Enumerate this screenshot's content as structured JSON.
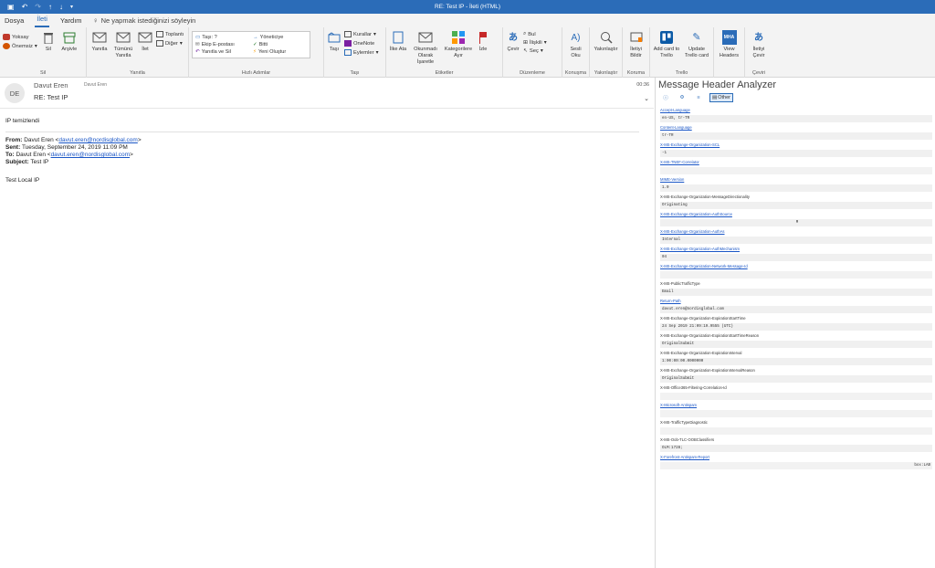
{
  "titlebar": {
    "title": "RE: Test IP  -  İleti (HTML)",
    "save_icon": "save-icon",
    "undo_icon": "undo-icon"
  },
  "tabs": [
    "Dosya",
    "İleti",
    "Yardım"
  ],
  "active_tab": "İleti",
  "tellme": "Ne yapmak istediğinizi söyleyin",
  "ribbon": {
    "sil": {
      "label": "Sil",
      "yoksay": "Yoksay",
      "onemsiz": "Önemsiz",
      "sil_btn": "Sil",
      "arsivle": "Arşivle"
    },
    "yanitla": {
      "label": "Yanıtla",
      "yanitla_btn": "Yanıtla",
      "tumunu": "Tümünü Yanıtla",
      "ilet": "İlet",
      "toplanti": "Toplantı",
      "diger": "Diğer"
    },
    "hizli": {
      "label": "Hızlı Adımlar",
      "items": [
        "Taşı: ?",
        "Yöneticiye",
        "Ekip E-postası",
        "Bitti",
        "Yanıtla ve Sil",
        "Yeni Oluştur"
      ]
    },
    "tasi": {
      "label": "Taşı",
      "tasi_btn": "Taşı",
      "kurallar": "Kurallar",
      "onenote": "OneNote",
      "eylemler": "Eylemler"
    },
    "etiketler": {
      "label": "Etiketler",
      "ilke": "İlke Ata",
      "okunmadi": "Okunmadı Olarak İşaretle",
      "kategoriler": "Kategorilere Ayır",
      "izle": "İzle"
    },
    "duzenleme": {
      "label": "Düzenleme",
      "cevir": "Çevir",
      "bul": "Bul",
      "ilgili": "İlişkili",
      "sec": "Seç"
    },
    "konusma": {
      "label": "Konuşma",
      "sesli": "Sesli Oku"
    },
    "yakinlastir": {
      "label": "Yakınlaştır",
      "btn": "Yakınlaştır"
    },
    "koruma": {
      "label": "Koruma",
      "btn": "İletiyi Bildir"
    },
    "trello": {
      "label": "Trello",
      "add": "Add card to Trello",
      "update": "Update Trello card"
    },
    "mha": {
      "label": "",
      "btn": "View Headers",
      "icon_text": "MHA"
    },
    "ceviri": {
      "label": "Çeviri",
      "btn": "İletiyi Çevir"
    }
  },
  "message": {
    "avatar": "DE",
    "sender": "Davut Eren",
    "sender_small": "Davut Eren",
    "subject": "RE: Test IP",
    "time": "00:36",
    "greeting": "IP temizlendi",
    "from_label": "From:",
    "from_name": "Davut Eren <",
    "from_email": "davut.eren@nordisglobal.com",
    "from_close": ">",
    "sent_label": "Sent:",
    "sent_value": "Tuesday, September 24, 2019 11:09 PM",
    "to_label": "To:",
    "to_name": "Davut Eren <",
    "to_email": "davut.eren@nordisglobal.com",
    "to_close": ">",
    "subj_label": "Subject:",
    "subj_value": "Test IP",
    "text": "Test Local IP"
  },
  "mha": {
    "title": "Message Header Analyzer",
    "other_tab": "Other",
    "headers": [
      {
        "name": "Accept-Language",
        "link": true,
        "value": "en-US, tr-TR"
      },
      {
        "name": "Content-Language",
        "link": true,
        "value": "tr-TR"
      },
      {
        "name": "X-MS-Exchange-Organization-SCL",
        "link": true,
        "value": "-1"
      },
      {
        "name": "X-MS-TNEF-Correlator",
        "link": true,
        "value": ""
      },
      {
        "name": "MIME-Version",
        "link": true,
        "value": "1.0"
      },
      {
        "name": "X-MS-Exchange-Organization-MessageDirectionality",
        "link": false,
        "value": "Originating"
      },
      {
        "name": "X-MS-Exchange-Organization-AuthSource",
        "link": true,
        "value": "M"
      },
      {
        "name": "X-MS-Exchange-Organization-AuthAs",
        "link": true,
        "value": "Internal"
      },
      {
        "name": "X-MS-Exchange-Organization-AuthMechanism",
        "link": true,
        "value": "04"
      },
      {
        "name": "X-MS-Exchange-Organization-Network-Message-Id",
        "link": true,
        "value": ""
      },
      {
        "name": "X-MS-PublicTrafficType",
        "link": false,
        "value": "Email"
      },
      {
        "name": "Return-Path",
        "link": true,
        "value": "davut.eren@nordisglobal.com"
      },
      {
        "name": "X-MS-Exchange-Organization-ExpirationStartTime",
        "link": false,
        "value": "24 Sep 2019 21:09:19.9555 (UTC)"
      },
      {
        "name": "X-MS-Exchange-Organization-ExpirationStartTimeReason",
        "link": false,
        "value": "OriginalSubmit"
      },
      {
        "name": "X-MS-Exchange-Organization-ExpirationInterval",
        "link": false,
        "value": "1:00:00:00.0000000"
      },
      {
        "name": "X-MS-Exchange-Organization-ExpirationIntervalReason",
        "link": false,
        "value": "OriginalSubmit"
      },
      {
        "name": "X-MS-Office365-Filtering-Correlation-Id",
        "link": false,
        "value": ""
      },
      {
        "name": "X-Microsoft-Antispam",
        "link": true,
        "value": ""
      },
      {
        "name": "X-MS-TrafficTypeDiagnostic",
        "link": false,
        "value": ""
      },
      {
        "name": "X-MS-Oob-TLC-OOBClassifiers",
        "link": false,
        "value": "OLM:1728;"
      },
      {
        "name": "X-Forefront-Antispam-Report",
        "link": true,
        "value": ""
      }
    ],
    "last_value_right": "box:LAB"
  }
}
